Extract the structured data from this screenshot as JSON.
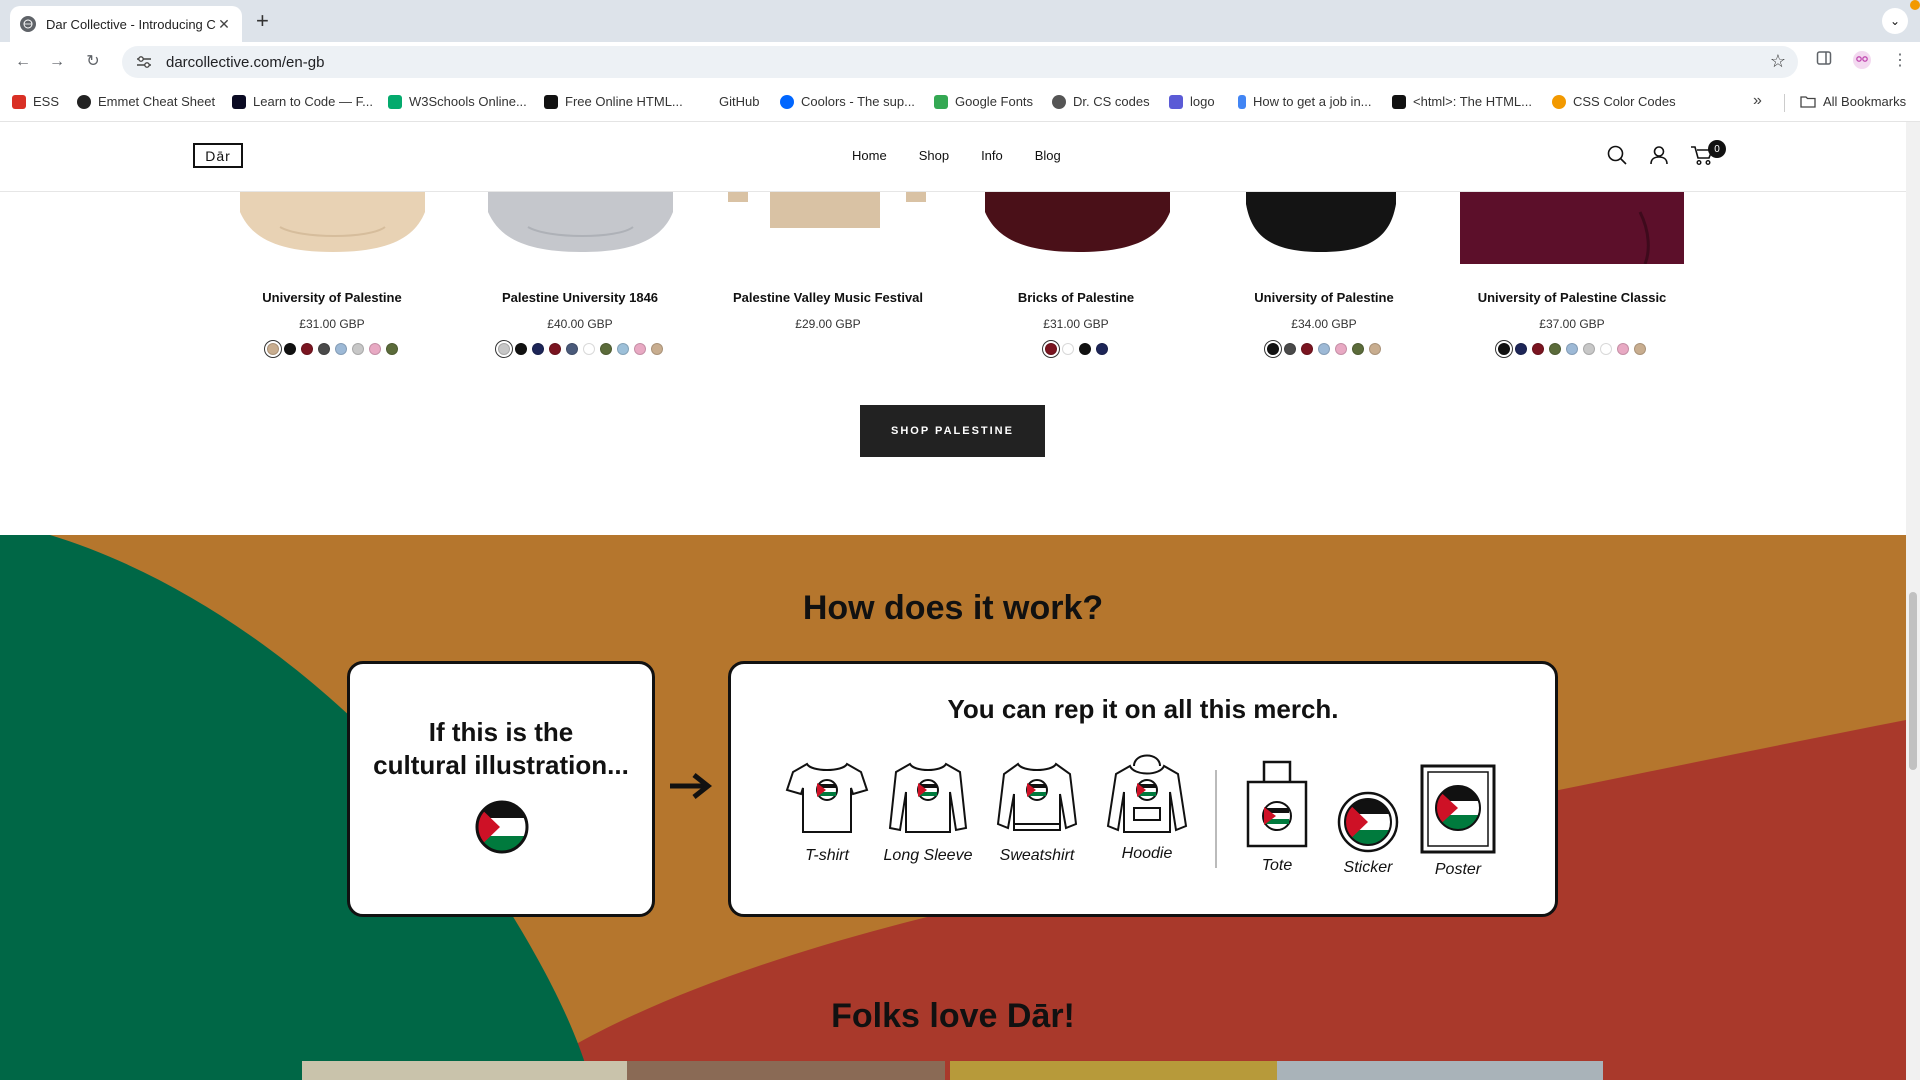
{
  "browser": {
    "tab_title": "Dar Collective - Introducing C",
    "url": "darcollective.com/en-gb",
    "bookmarks": [
      "ESS",
      "Emmet Cheat Sheet",
      "Learn to Code — F...",
      "W3Schools Online...",
      "Free Online HTML...",
      "GitHub",
      "Coolors - The sup...",
      "Google Fonts",
      "Dr. CS codes",
      "logo",
      "How to get a job in...",
      "<html>: The HTML...",
      "CSS Color Codes"
    ],
    "all_bookmarks": "All Bookmarks"
  },
  "site": {
    "logo": "Dār",
    "nav": [
      "Home",
      "Shop",
      "Info",
      "Blog"
    ],
    "cart_count": "0"
  },
  "products": [
    {
      "name": "University of Palestine",
      "price": "£31.00 GBP",
      "swatches": [
        "#c8ad8f",
        "#111111",
        "#7a1420",
        "#4a4a4a",
        "#9db9d6",
        "#c7c7c7",
        "#e8a9c3",
        "#5b6b3a"
      ],
      "selected": 0,
      "image_color": "#e8d2b4"
    },
    {
      "name": "Palestine University 1846",
      "price": "£40.00 GBP",
      "swatches": [
        "#c7c7c7",
        "#111111",
        "#1d2557",
        "#7a1420",
        "#4a5a7a",
        "#ffffff",
        "#5b6b3a",
        "#9dc0d9",
        "#e8a9c3",
        "#c8ad8f"
      ],
      "selected": 0,
      "image_color": "#c5c7cc"
    },
    {
      "name": "Palestine Valley Music Festival",
      "price": "£29.00 GBP",
      "swatches": [],
      "selected": -1,
      "image_color": "#d9c2a4"
    },
    {
      "name": "Bricks of Palestine",
      "price": "£31.00 GBP",
      "swatches": [
        "#7a1420",
        "#ffffff",
        "#111111",
        "#1d2557"
      ],
      "selected": 0,
      "image_color": "#4a1018"
    },
    {
      "name": "University of Palestine",
      "price": "£34.00 GBP",
      "swatches": [
        "#111111",
        "#4a4a4a",
        "#7a1420",
        "#9db9d6",
        "#e8a9c3",
        "#5b6b3a",
        "#c8ad8f"
      ],
      "selected": 0,
      "image_color": "#141414"
    },
    {
      "name": "University of Palestine Classic",
      "price": "£37.00 GBP",
      "swatches": [
        "#111111",
        "#1d2557",
        "#7a1420",
        "#5b6b3a",
        "#9db9d6",
        "#c7c7c7",
        "#ffffff",
        "#e8a9c3",
        "#c8ad8f"
      ],
      "selected": 0,
      "image_color": "#5c0f2a"
    }
  ],
  "shop_button": "SHOP PALESTINE",
  "how": {
    "title": "How does it work?",
    "card1_line1": "If this is the",
    "card1_line2": "cultural illustration...",
    "card2_title": "You can rep it on all this merch.",
    "merch": [
      "T-shirt",
      "Long Sleeve",
      "Sweatshirt",
      "Hoodie",
      "Tote",
      "Sticker",
      "Poster"
    ]
  },
  "folks_title": "Folks love Dār!",
  "colors": {
    "green": "#006746",
    "ochre": "#b5762d",
    "red": "#a9392b",
    "flag_green": "#007a3d",
    "flag_red": "#ce1126"
  }
}
